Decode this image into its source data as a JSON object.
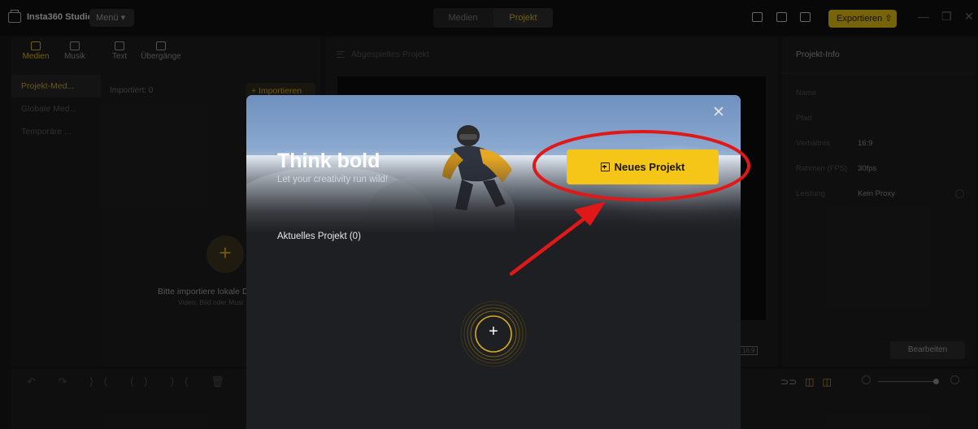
{
  "titlebar": {
    "app_name": "Insta360 Studio",
    "menu_label": "Menü ▾",
    "tabs": [
      {
        "label": "Medien"
      },
      {
        "label": "Projekt"
      }
    ],
    "export_label": "Exportieren ⇧",
    "window_min": "—",
    "window_restore": "❐",
    "window_close": "✕"
  },
  "left_panel": {
    "tabs": [
      {
        "label": "Medien",
        "icon": "folder-icon"
      },
      {
        "label": "Musik",
        "icon": "music-icon"
      },
      {
        "label": "Text",
        "icon": "text-icon"
      },
      {
        "label": "Übergänge",
        "icon": "transition-icon"
      }
    ],
    "sidebar": [
      {
        "label": "Projekt-Med..."
      },
      {
        "label": "Globale Med..."
      },
      {
        "label": "Temporäre ..."
      }
    ],
    "imported": "Importiert: 0",
    "import_button": "+ Importieren",
    "empty_plus": "+",
    "empty_hint_title": "Bitte importiere lokale D",
    "empty_hint_sub": "Video, Bild oder Musi"
  },
  "center_panel": {
    "header": "Abgespieltes Projekt",
    "ratio_badge": "16:9"
  },
  "right_panel": {
    "title": "Projekt-Info",
    "rows": [
      {
        "label": "Name",
        "value": ""
      },
      {
        "label": "Pfad",
        "value": ""
      },
      {
        "label": "Verhältnis",
        "value": "16:9"
      },
      {
        "label": "Rahmen (FPS)",
        "value": "30fps"
      },
      {
        "label": "Leistung",
        "value": "Kein Proxy"
      }
    ],
    "edit_button": "Bearbeiten"
  },
  "timeline": {
    "tools": "↶ ↷ ⟩⟨ ⟨⟩ ⟩⟨ 🗑",
    "right_icons": [
      "⊃⊃",
      "◫",
      "◫"
    ]
  },
  "modal": {
    "hero_title": "Think bold",
    "hero_subtitle": "Let your creativity run wild!",
    "close": "✕",
    "new_project_button": "Neues Projekt",
    "recent_label": "Aktuelles Projekt (0)",
    "create_plus": "+"
  },
  "colors": {
    "accent_yellow": "#f5c518",
    "active_gold": "#d4aa1f",
    "annotation_red": "#e01818"
  }
}
